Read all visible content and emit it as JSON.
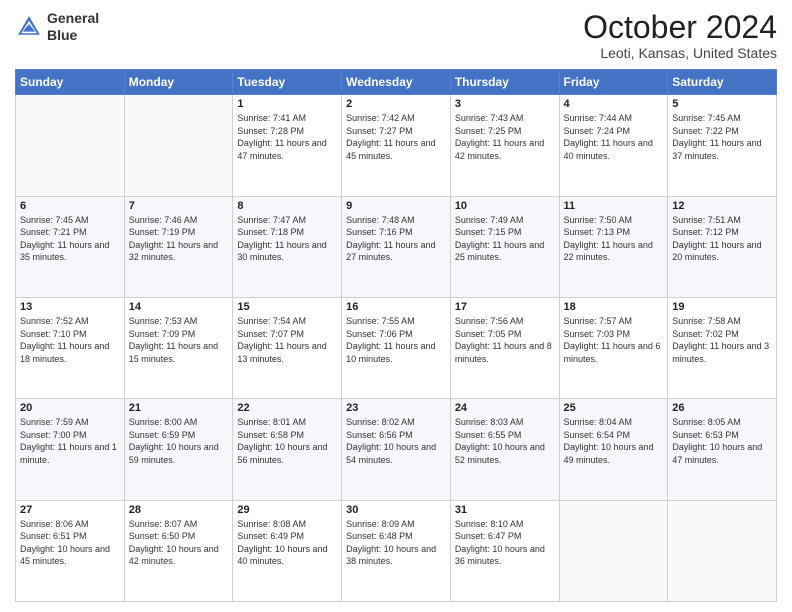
{
  "header": {
    "logo_line1": "General",
    "logo_line2": "Blue",
    "month_title": "October 2024",
    "location": "Leoti, Kansas, United States"
  },
  "days_of_week": [
    "Sunday",
    "Monday",
    "Tuesday",
    "Wednesday",
    "Thursday",
    "Friday",
    "Saturday"
  ],
  "weeks": [
    [
      {
        "day": "",
        "sunrise": "",
        "sunset": "",
        "daylight": ""
      },
      {
        "day": "",
        "sunrise": "",
        "sunset": "",
        "daylight": ""
      },
      {
        "day": "1",
        "sunrise": "Sunrise: 7:41 AM",
        "sunset": "Sunset: 7:28 PM",
        "daylight": "Daylight: 11 hours and 47 minutes."
      },
      {
        "day": "2",
        "sunrise": "Sunrise: 7:42 AM",
        "sunset": "Sunset: 7:27 PM",
        "daylight": "Daylight: 11 hours and 45 minutes."
      },
      {
        "day": "3",
        "sunrise": "Sunrise: 7:43 AM",
        "sunset": "Sunset: 7:25 PM",
        "daylight": "Daylight: 11 hours and 42 minutes."
      },
      {
        "day": "4",
        "sunrise": "Sunrise: 7:44 AM",
        "sunset": "Sunset: 7:24 PM",
        "daylight": "Daylight: 11 hours and 40 minutes."
      },
      {
        "day": "5",
        "sunrise": "Sunrise: 7:45 AM",
        "sunset": "Sunset: 7:22 PM",
        "daylight": "Daylight: 11 hours and 37 minutes."
      }
    ],
    [
      {
        "day": "6",
        "sunrise": "Sunrise: 7:45 AM",
        "sunset": "Sunset: 7:21 PM",
        "daylight": "Daylight: 11 hours and 35 minutes."
      },
      {
        "day": "7",
        "sunrise": "Sunrise: 7:46 AM",
        "sunset": "Sunset: 7:19 PM",
        "daylight": "Daylight: 11 hours and 32 minutes."
      },
      {
        "day": "8",
        "sunrise": "Sunrise: 7:47 AM",
        "sunset": "Sunset: 7:18 PM",
        "daylight": "Daylight: 11 hours and 30 minutes."
      },
      {
        "day": "9",
        "sunrise": "Sunrise: 7:48 AM",
        "sunset": "Sunset: 7:16 PM",
        "daylight": "Daylight: 11 hours and 27 minutes."
      },
      {
        "day": "10",
        "sunrise": "Sunrise: 7:49 AM",
        "sunset": "Sunset: 7:15 PM",
        "daylight": "Daylight: 11 hours and 25 minutes."
      },
      {
        "day": "11",
        "sunrise": "Sunrise: 7:50 AM",
        "sunset": "Sunset: 7:13 PM",
        "daylight": "Daylight: 11 hours and 22 minutes."
      },
      {
        "day": "12",
        "sunrise": "Sunrise: 7:51 AM",
        "sunset": "Sunset: 7:12 PM",
        "daylight": "Daylight: 11 hours and 20 minutes."
      }
    ],
    [
      {
        "day": "13",
        "sunrise": "Sunrise: 7:52 AM",
        "sunset": "Sunset: 7:10 PM",
        "daylight": "Daylight: 11 hours and 18 minutes."
      },
      {
        "day": "14",
        "sunrise": "Sunrise: 7:53 AM",
        "sunset": "Sunset: 7:09 PM",
        "daylight": "Daylight: 11 hours and 15 minutes."
      },
      {
        "day": "15",
        "sunrise": "Sunrise: 7:54 AM",
        "sunset": "Sunset: 7:07 PM",
        "daylight": "Daylight: 11 hours and 13 minutes."
      },
      {
        "day": "16",
        "sunrise": "Sunrise: 7:55 AM",
        "sunset": "Sunset: 7:06 PM",
        "daylight": "Daylight: 11 hours and 10 minutes."
      },
      {
        "day": "17",
        "sunrise": "Sunrise: 7:56 AM",
        "sunset": "Sunset: 7:05 PM",
        "daylight": "Daylight: 11 hours and 8 minutes."
      },
      {
        "day": "18",
        "sunrise": "Sunrise: 7:57 AM",
        "sunset": "Sunset: 7:03 PM",
        "daylight": "Daylight: 11 hours and 6 minutes."
      },
      {
        "day": "19",
        "sunrise": "Sunrise: 7:58 AM",
        "sunset": "Sunset: 7:02 PM",
        "daylight": "Daylight: 11 hours and 3 minutes."
      }
    ],
    [
      {
        "day": "20",
        "sunrise": "Sunrise: 7:59 AM",
        "sunset": "Sunset: 7:00 PM",
        "daylight": "Daylight: 11 hours and 1 minute."
      },
      {
        "day": "21",
        "sunrise": "Sunrise: 8:00 AM",
        "sunset": "Sunset: 6:59 PM",
        "daylight": "Daylight: 10 hours and 59 minutes."
      },
      {
        "day": "22",
        "sunrise": "Sunrise: 8:01 AM",
        "sunset": "Sunset: 6:58 PM",
        "daylight": "Daylight: 10 hours and 56 minutes."
      },
      {
        "day": "23",
        "sunrise": "Sunrise: 8:02 AM",
        "sunset": "Sunset: 6:56 PM",
        "daylight": "Daylight: 10 hours and 54 minutes."
      },
      {
        "day": "24",
        "sunrise": "Sunrise: 8:03 AM",
        "sunset": "Sunset: 6:55 PM",
        "daylight": "Daylight: 10 hours and 52 minutes."
      },
      {
        "day": "25",
        "sunrise": "Sunrise: 8:04 AM",
        "sunset": "Sunset: 6:54 PM",
        "daylight": "Daylight: 10 hours and 49 minutes."
      },
      {
        "day": "26",
        "sunrise": "Sunrise: 8:05 AM",
        "sunset": "Sunset: 6:53 PM",
        "daylight": "Daylight: 10 hours and 47 minutes."
      }
    ],
    [
      {
        "day": "27",
        "sunrise": "Sunrise: 8:06 AM",
        "sunset": "Sunset: 6:51 PM",
        "daylight": "Daylight: 10 hours and 45 minutes."
      },
      {
        "day": "28",
        "sunrise": "Sunrise: 8:07 AM",
        "sunset": "Sunset: 6:50 PM",
        "daylight": "Daylight: 10 hours and 42 minutes."
      },
      {
        "day": "29",
        "sunrise": "Sunrise: 8:08 AM",
        "sunset": "Sunset: 6:49 PM",
        "daylight": "Daylight: 10 hours and 40 minutes."
      },
      {
        "day": "30",
        "sunrise": "Sunrise: 8:09 AM",
        "sunset": "Sunset: 6:48 PM",
        "daylight": "Daylight: 10 hours and 38 minutes."
      },
      {
        "day": "31",
        "sunrise": "Sunrise: 8:10 AM",
        "sunset": "Sunset: 6:47 PM",
        "daylight": "Daylight: 10 hours and 36 minutes."
      },
      {
        "day": "",
        "sunrise": "",
        "sunset": "",
        "daylight": ""
      },
      {
        "day": "",
        "sunrise": "",
        "sunset": "",
        "daylight": ""
      }
    ]
  ]
}
